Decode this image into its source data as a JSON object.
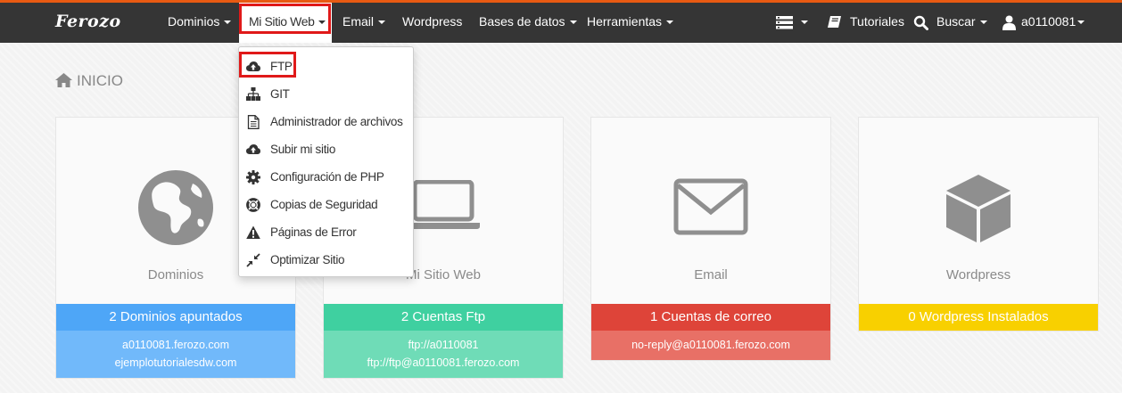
{
  "brand": {
    "logo": "Ferozo",
    "accent": "#e85a12",
    "navbar_bg": "#353535",
    "highlight_border": "#e01919"
  },
  "nav": {
    "items": [
      "Dominios",
      "Mi Sitio Web",
      "Email",
      "Wordpress",
      "Bases de datos",
      "Herramientas"
    ],
    "active": "Mi Sitio Web",
    "right": {
      "menu_icon": "list-icon",
      "tutorials": "Tutoriales",
      "search": "Buscar",
      "user": "a0110081"
    }
  },
  "dropdown": {
    "items": [
      {
        "label": "FTP",
        "icon": "cloud-upload-icon",
        "highlighted": true
      },
      {
        "label": "GIT",
        "icon": "sitemap-icon"
      },
      {
        "label": "Administrador de archivos",
        "icon": "file-icon"
      },
      {
        "label": "Subir mi sitio",
        "icon": "cloud-upload-icon"
      },
      {
        "label": "Configuración de PHP",
        "icon": "gear-icon"
      },
      {
        "label": "Copias de Seguridad",
        "icon": "life-ring-icon"
      },
      {
        "label": "Páginas de Error",
        "icon": "warning-icon"
      },
      {
        "label": "Optimizar Sitio",
        "icon": "compress-icon"
      }
    ]
  },
  "page": {
    "title": "INICIO",
    "title_icon": "home-icon"
  },
  "cards": [
    {
      "label": "Dominios",
      "icon": "globe-icon",
      "stat": "2 Dominios apuntados",
      "stat_color": "#4ea6f7",
      "list_color": "#71b9fa",
      "items": [
        "a0110081.ferozo.com",
        "ejemplotutorialesdw.com"
      ]
    },
    {
      "label": "Mi Sitio Web",
      "icon": "laptop-icon",
      "stat": "2 Cuentas Ftp",
      "stat_color": "#3fd0a0",
      "list_color": "#6fdcb7",
      "items": [
        "ftp://a0110081",
        "ftp://ftp@a0110081.ferozo.com"
      ]
    },
    {
      "label": "Email",
      "icon": "envelope-icon",
      "stat": "1 Cuentas de correo",
      "stat_color": "#de4439",
      "list_color": "#e87066",
      "items": [
        "no-reply@a0110081.ferozo.com"
      ]
    },
    {
      "label": "Wordpress",
      "icon": "cube-icon",
      "stat": "0 Wordpress Instalados",
      "stat_color": "#f8d000",
      "list_color": "",
      "items": []
    }
  ]
}
